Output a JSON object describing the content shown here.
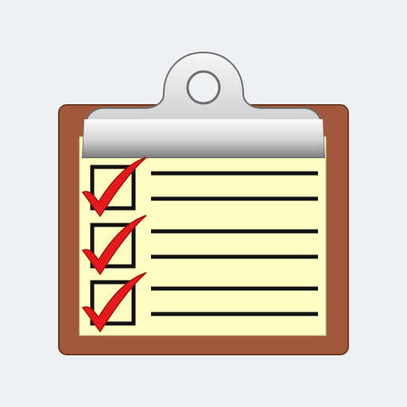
{
  "icon": {
    "name": "clipboard-checklist-icon",
    "board_color": "#a0593a",
    "paper_color": "#fefdc4",
    "clip_color": "#b9b9b9",
    "check_color": "#e51a1a",
    "line_color": "#111111",
    "background_color": "#eef0f3"
  },
  "checklist": {
    "items": [
      {
        "checked": true
      },
      {
        "checked": true
      },
      {
        "checked": true
      }
    ]
  }
}
